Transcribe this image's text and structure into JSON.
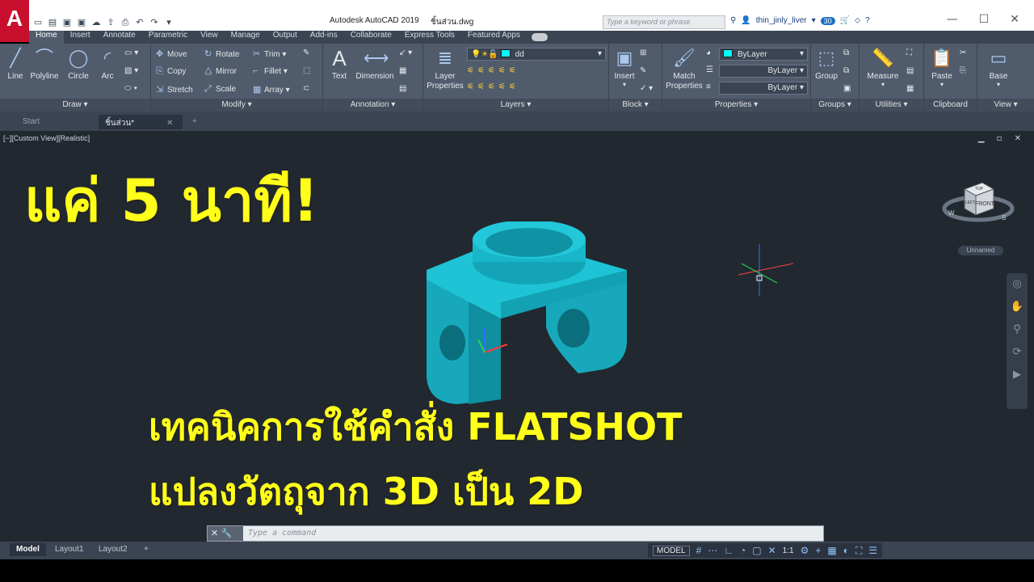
{
  "app": {
    "logo": "A",
    "title": "Autodesk AutoCAD 2019",
    "file": "ชิ้นส่วน.dwg",
    "search_placeholder": "Type a keyword or phrase",
    "user": "thin_jinly_liver",
    "badge": "30",
    "help": "?"
  },
  "ribbon_tabs": [
    "Home",
    "Insert",
    "Annotate",
    "Parametric",
    "View",
    "Manage",
    "Output",
    "Add-ins",
    "Collaborate",
    "Express Tools",
    "Featured Apps"
  ],
  "draw": {
    "title": "Draw ▾",
    "line": "Line",
    "polyline": "Polyline",
    "circle": "Circle",
    "arc": "Arc"
  },
  "modify": {
    "title": "Modify ▾",
    "move": "Move",
    "rotate": "Rotate",
    "trim": "Trim ▾",
    "copy": "Copy",
    "mirror": "Mirror",
    "fillet": "Fillet ▾",
    "stretch": "Stretch",
    "scale": "Scale",
    "array": "Array ▾"
  },
  "annotation": {
    "title": "Annotation ▾",
    "text": "Text",
    "dimension": "Dimension"
  },
  "layers": {
    "title": "Layers ▾",
    "layer_properties": "Layer Properties",
    "current_layer": "dd"
  },
  "block": {
    "title": "Block ▾",
    "insert": "Insert"
  },
  "properties": {
    "title": "Properties ▾",
    "match": "Match Properties",
    "color": "ByLayer",
    "linetype": "ByLayer",
    "lineweight": "ByLayer"
  },
  "groups": {
    "title": "Groups ▾",
    "group": "Group"
  },
  "utilities": {
    "title": "Utilities ▾",
    "measure": "Measure"
  },
  "clipboard": {
    "title": "Clipboard",
    "paste": "Paste"
  },
  "view_panel": {
    "title": "View ▾",
    "base": "Base"
  },
  "file_tabs": {
    "start": "Start",
    "active": "ชิ้นส่วน*",
    "close": "✕",
    "add": "+"
  },
  "viewport": {
    "label": "[−][Custom View][Realistic]",
    "controls": "▁ ▫ ✕",
    "headline": "แค่ 5 นาที!",
    "line1": "เทคนิคการใช้คำสั่ง FLATSHOT",
    "line2": "แปลงวัตถุจาก 3D เป็น 2D",
    "viewcube_face": "FRONT",
    "viewcube_top": "TOP",
    "viewcube_left": "LEFT",
    "compass_w": "W",
    "compass_s": "S",
    "ucs_name": "Unnamed"
  },
  "command": {
    "placeholder": "Type a command"
  },
  "status": {
    "model_tab": "Model",
    "layout1": "Layout1",
    "layout2": "Layout2",
    "add": "+",
    "model": "MODEL",
    "scale": "1:1"
  },
  "colors": {
    "accent": "#ffff1a",
    "part": "#19b4c8",
    "viewport_bg": "#212830"
  }
}
